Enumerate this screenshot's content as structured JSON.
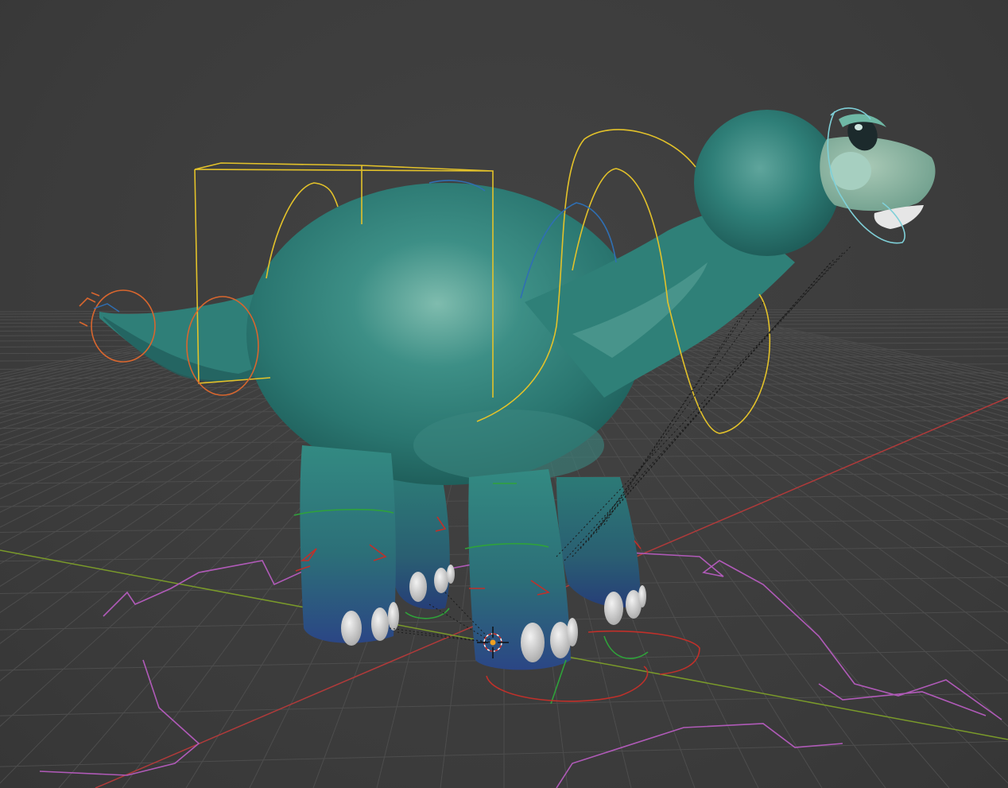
{
  "viewport": {
    "background": "#3d3d3d",
    "grid_color": "#4d4d4d",
    "x_axis_color": "#b03a3a",
    "y_axis_color": "#7a9a2a"
  },
  "scene": {
    "object": "dinosaur-mesh",
    "body_color": "#2e7f78",
    "body_highlight": "#6fb3a6",
    "belly_color": "#8fb7a6",
    "foot_color": "#2f4a86",
    "toenail_color": "#d9d9d9",
    "rig_controls": {
      "cog_box": "#e3c22a",
      "spine_rings": "#e3c22a",
      "ik_rings_green": "#2fa23a",
      "foot_controls_red": "#c0302a",
      "tail_controls_orange": "#d8662e",
      "spline_blue": "#2f6fb3",
      "root_control_magenta": "#b05ab8",
      "head_control_cyan": "#7fd0d8"
    },
    "icons": [
      "3d-cursor-icon"
    ]
  }
}
